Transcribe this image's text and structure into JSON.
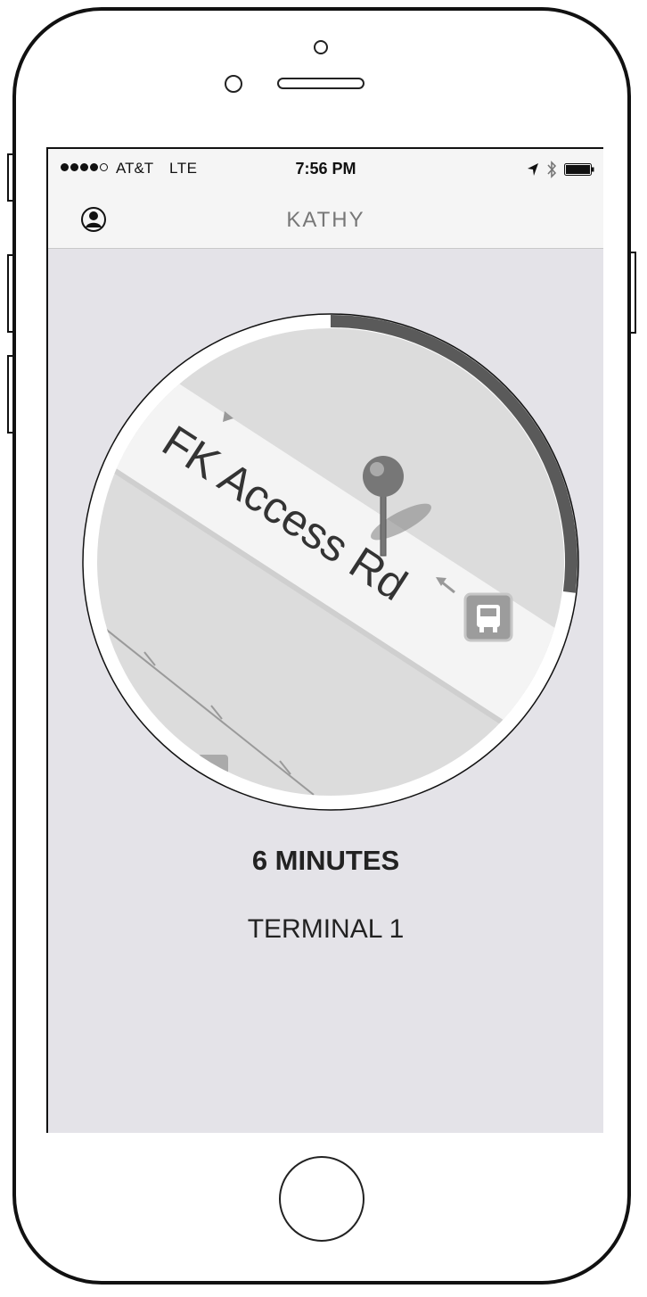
{
  "status_bar": {
    "carrier": "AT&T",
    "network": "LTE",
    "time": "7:56 PM",
    "signal_bars_filled": 4,
    "signal_bars_total": 5,
    "icons": [
      "location-arrow-icon",
      "bluetooth-icon",
      "battery-icon"
    ]
  },
  "nav": {
    "title": "KATHY",
    "left_icon": "profile-icon"
  },
  "map": {
    "road_label": "FK Access Rd",
    "progress_ring_fraction": 0.27,
    "ring_color": "#5a5a5a",
    "icons": [
      "map-pin-icon",
      "bus-stop-icon",
      "direction-arrow-icon"
    ]
  },
  "eta": {
    "duration": "6 MINUTES",
    "destination": "TERMINAL 1"
  }
}
